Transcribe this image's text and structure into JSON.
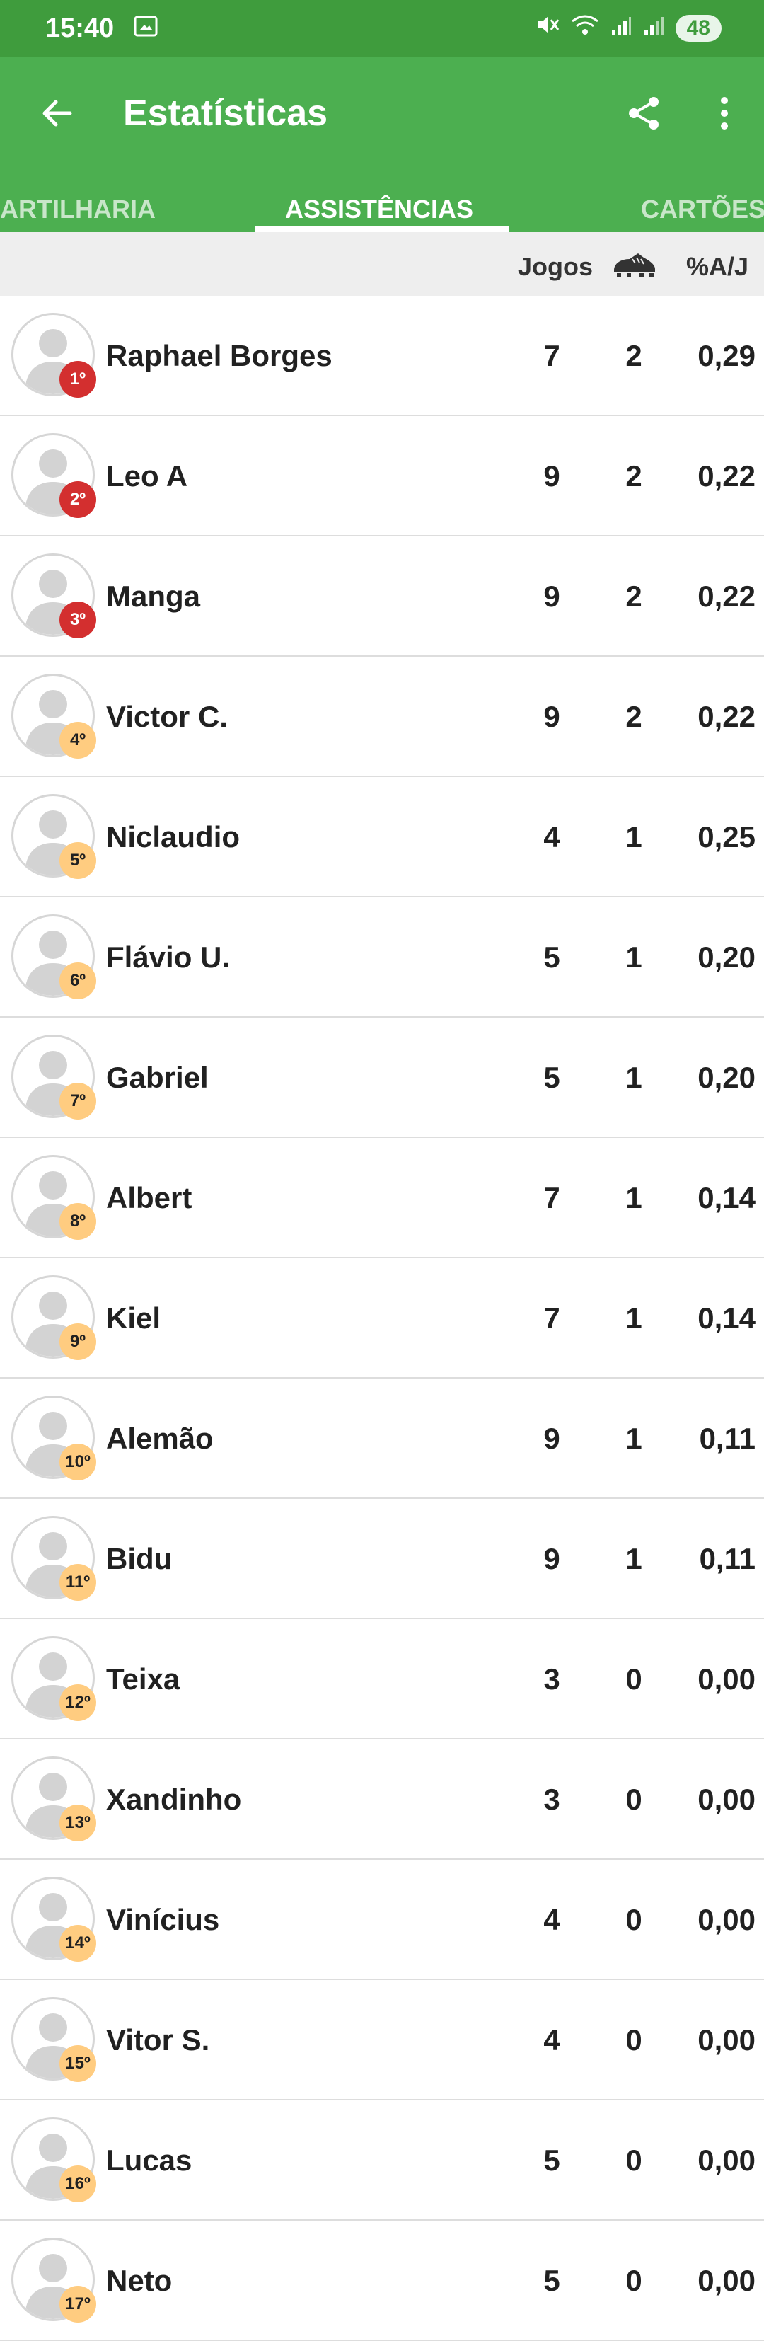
{
  "status_bar": {
    "time": "15:40",
    "battery": "48"
  },
  "app_bar": {
    "title": "Estatísticas"
  },
  "tabs": [
    {
      "label": "ARTILHARIA",
      "active": false
    },
    {
      "label": "ASSISTÊNCIAS",
      "active": true
    },
    {
      "label": "CARTÕES",
      "active": false
    }
  ],
  "table_header": {
    "games": "Jogos",
    "stat_icon": "soccer-cleat-icon",
    "pct": "%A/J"
  },
  "colors": {
    "status_bar": "#3f9c3d",
    "app_bar": "#4caf50",
    "rank_top": "#d32f2f",
    "rank_other": "#ffcc80"
  },
  "players": [
    {
      "rank": "1º",
      "name": "Raphael Borges",
      "games": "7",
      "assists": "2",
      "pct": "0,29"
    },
    {
      "rank": "2º",
      "name": "Leo A",
      "games": "9",
      "assists": "2",
      "pct": "0,22"
    },
    {
      "rank": "3º",
      "name": "Manga",
      "games": "9",
      "assists": "2",
      "pct": "0,22"
    },
    {
      "rank": "4º",
      "name": "Victor C.",
      "games": "9",
      "assists": "2",
      "pct": "0,22"
    },
    {
      "rank": "5º",
      "name": "Niclaudio",
      "games": "4",
      "assists": "1",
      "pct": "0,25"
    },
    {
      "rank": "6º",
      "name": "Flávio U.",
      "games": "5",
      "assists": "1",
      "pct": "0,20"
    },
    {
      "rank": "7º",
      "name": "Gabriel",
      "games": "5",
      "assists": "1",
      "pct": "0,20"
    },
    {
      "rank": "8º",
      "name": "Albert",
      "games": "7",
      "assists": "1",
      "pct": "0,14"
    },
    {
      "rank": "9º",
      "name": "Kiel",
      "games": "7",
      "assists": "1",
      "pct": "0,14"
    },
    {
      "rank": "10º",
      "name": "Alemão",
      "games": "9",
      "assists": "1",
      "pct": "0,11"
    },
    {
      "rank": "11º",
      "name": "Bidu",
      "games": "9",
      "assists": "1",
      "pct": "0,11"
    },
    {
      "rank": "12º",
      "name": "Teixa",
      "games": "3",
      "assists": "0",
      "pct": "0,00"
    },
    {
      "rank": "13º",
      "name": "Xandinho",
      "games": "3",
      "assists": "0",
      "pct": "0,00"
    },
    {
      "rank": "14º",
      "name": "Vinícius",
      "games": "4",
      "assists": "0",
      "pct": "0,00"
    },
    {
      "rank": "15º",
      "name": "Vitor S.",
      "games": "4",
      "assists": "0",
      "pct": "0,00"
    },
    {
      "rank": "16º",
      "name": "Lucas",
      "games": "5",
      "assists": "0",
      "pct": "0,00"
    },
    {
      "rank": "17º",
      "name": "Neto",
      "games": "5",
      "assists": "0",
      "pct": "0,00"
    }
  ]
}
